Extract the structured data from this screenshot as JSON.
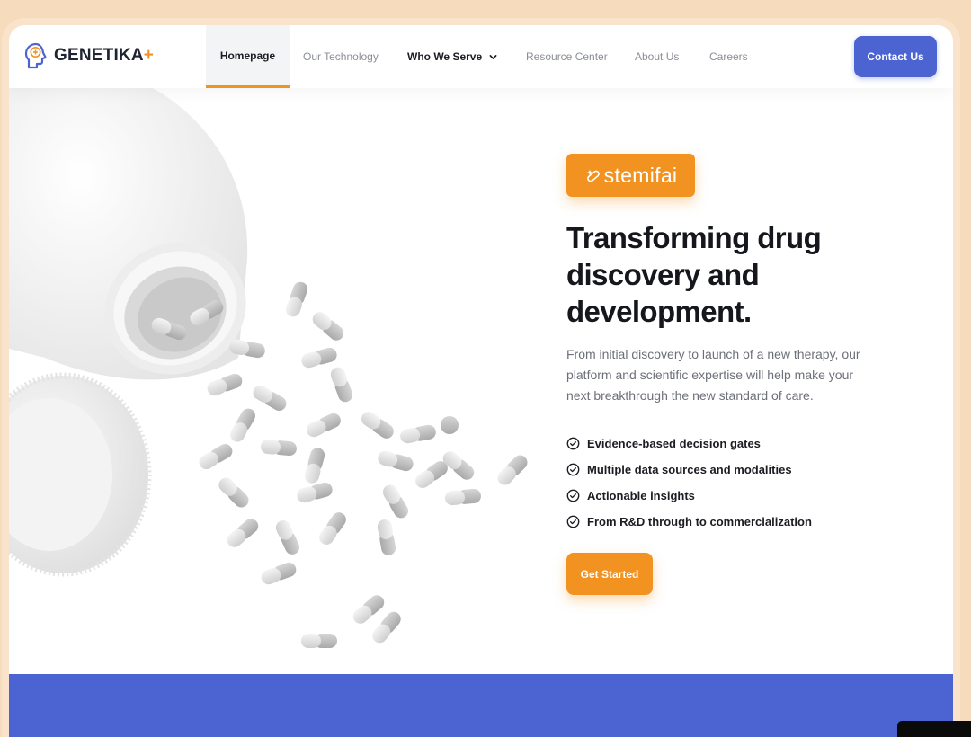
{
  "brand": {
    "name": "GENETIKA",
    "plus": "+",
    "logo_icon": "brain-head-icon",
    "colors": {
      "primary_blue": "#4c63d2",
      "accent_orange": "#f29220",
      "page_background": "#f6dcbc"
    }
  },
  "nav": {
    "items": [
      {
        "label": "Homepage",
        "active": true
      },
      {
        "label": "Our Technology",
        "active": false
      },
      {
        "label": "Who We Serve",
        "active": false,
        "has_dropdown": true
      },
      {
        "label": "Resource Center",
        "active": false
      },
      {
        "label": "About Us",
        "active": false
      },
      {
        "label": "Careers",
        "active": false
      }
    ],
    "contact_label": "Contact Us"
  },
  "hero": {
    "badge_text": "stemifai",
    "badge_icon": "pill-sparkle-icon",
    "headline_lines": [
      "Transforming drug",
      "discovery and",
      "development."
    ],
    "description": "From initial discovery to launch of a new therapy, our platform and scientific expertise will help make your next breakthrough the new standard of care.",
    "features": [
      "Evidence-based decision gates",
      "Multiple data sources and modalities",
      "Actionable insights",
      "From R&D through to commercialization"
    ],
    "cta_label": "Get Started",
    "image": "spilled-pill-bottle-illustration"
  }
}
